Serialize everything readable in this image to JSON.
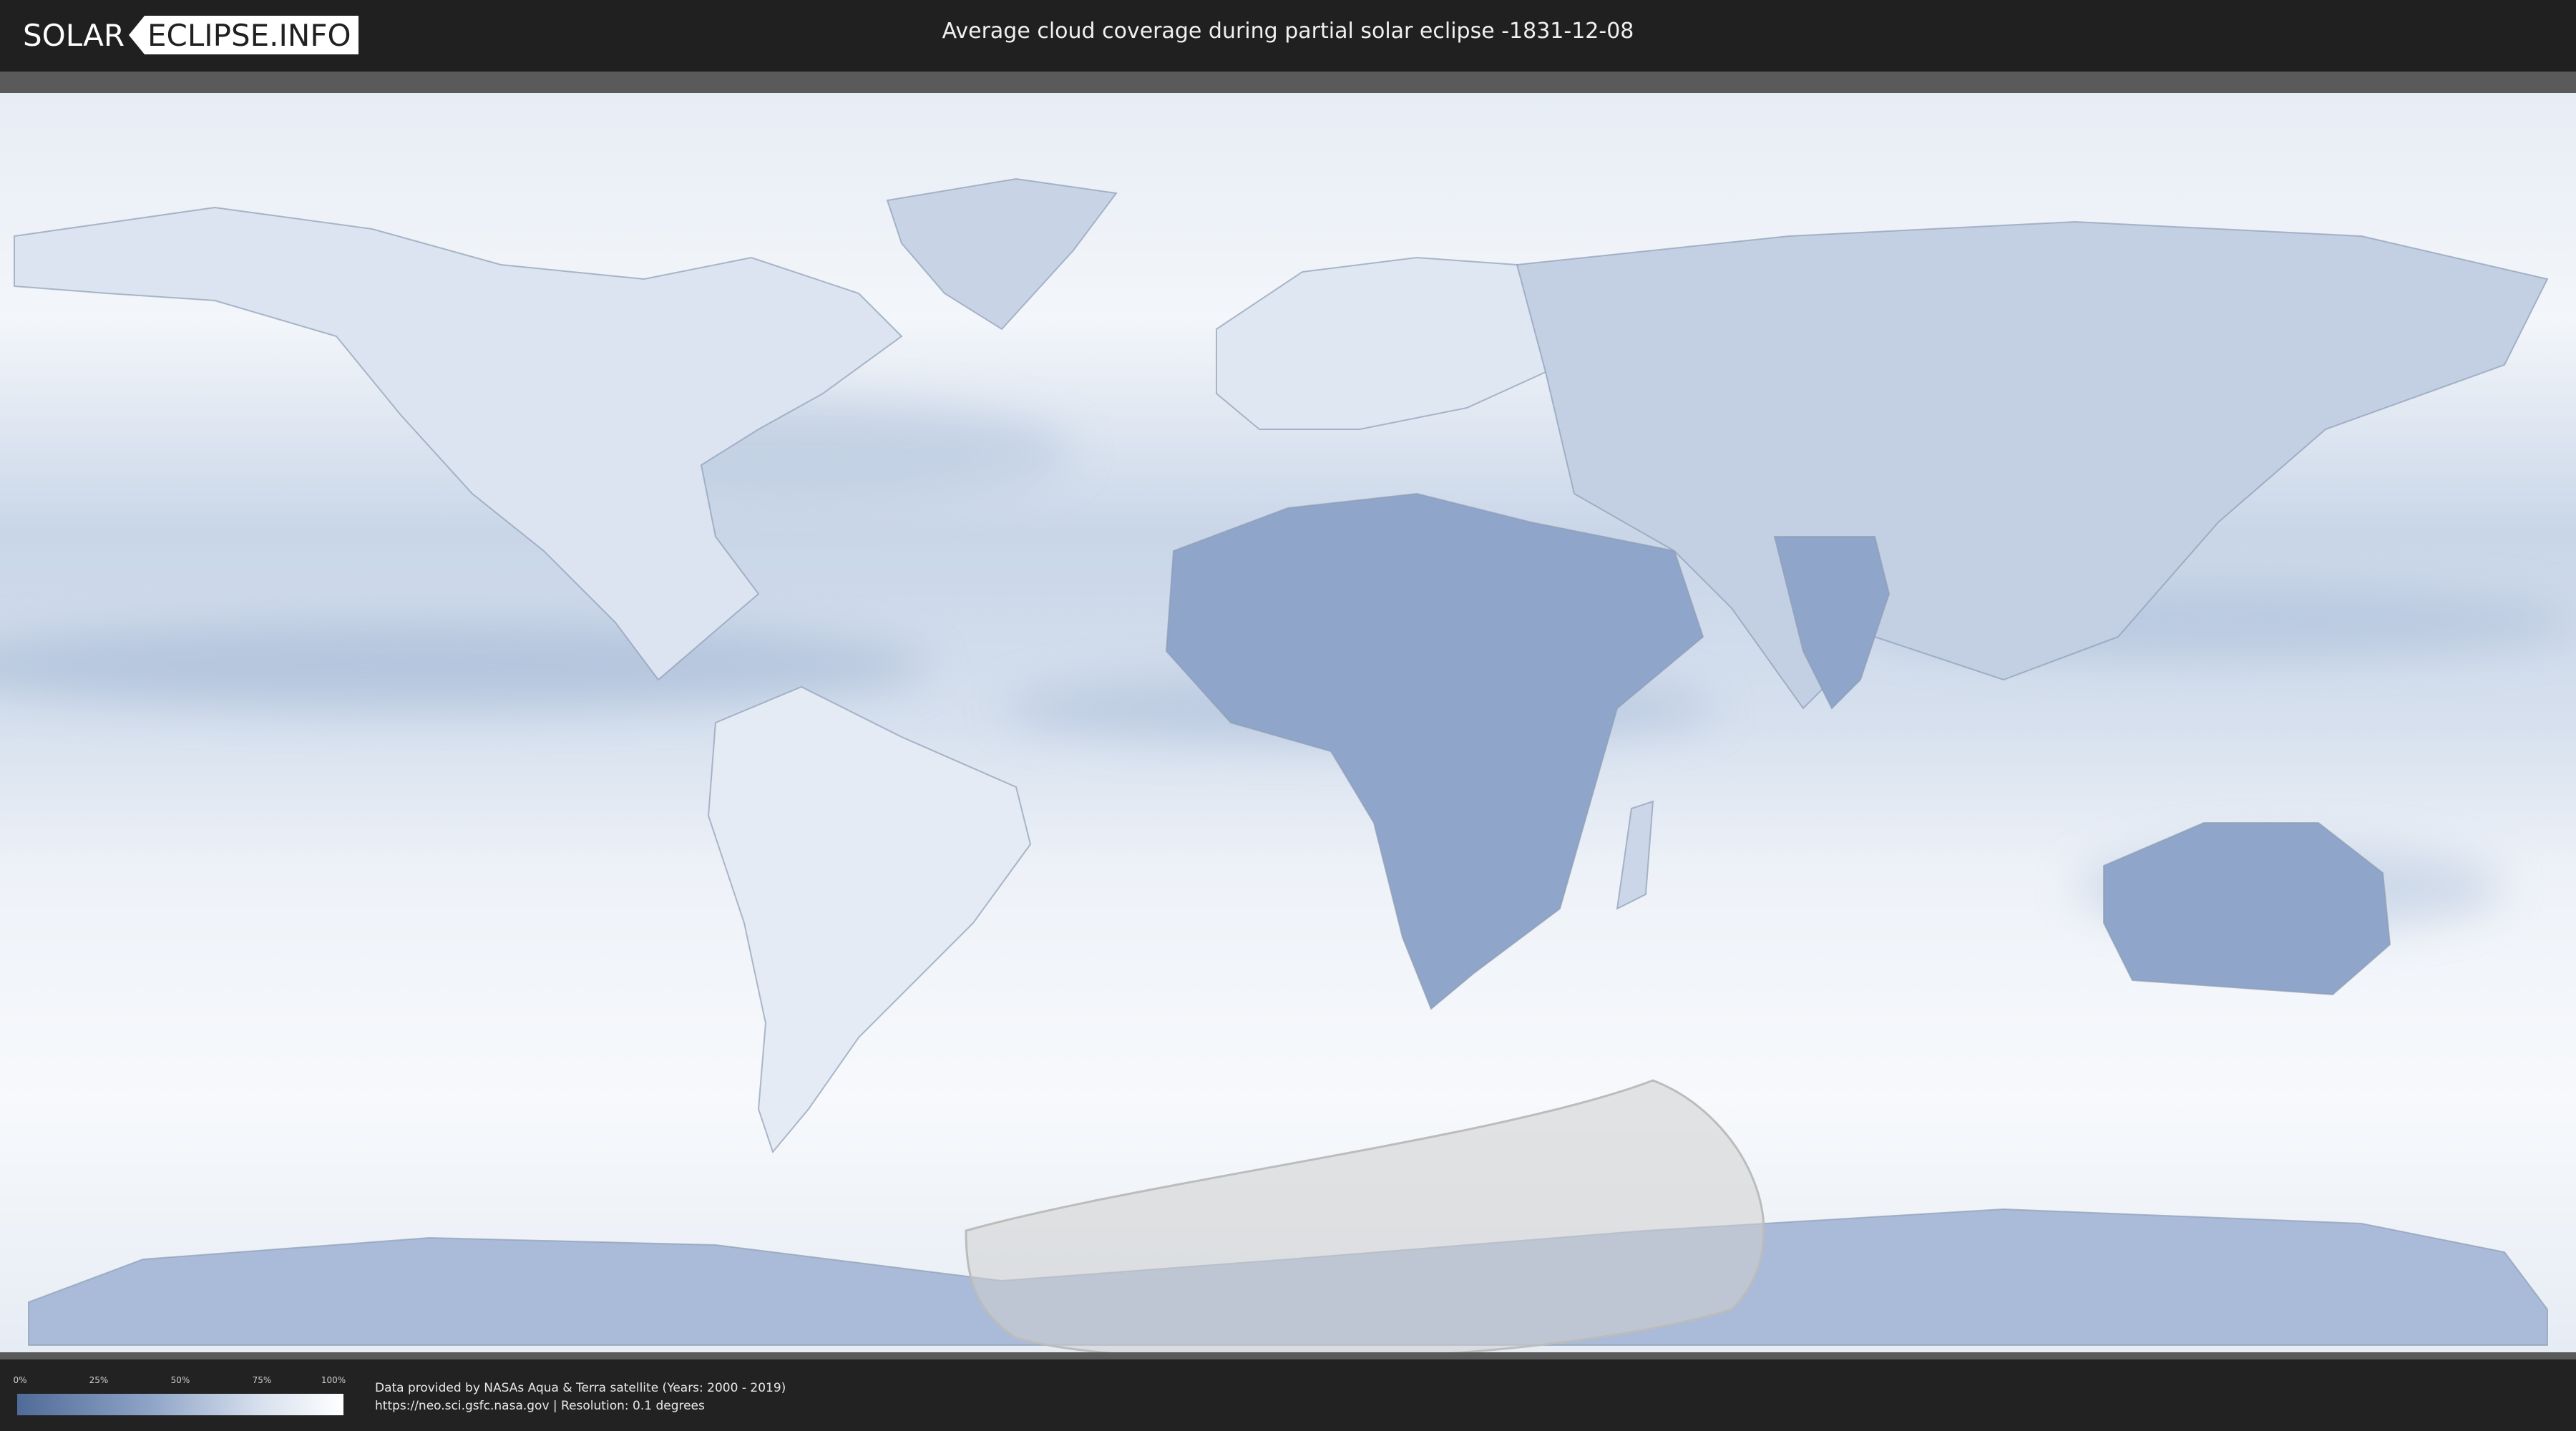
{
  "header": {
    "logo_left": "SOLAR",
    "logo_right": "ECLIPSE.INFO",
    "title": "Average cloud coverage during partial solar eclipse -1831-12-08"
  },
  "map": {
    "type": "world cloud coverage",
    "colors": {
      "clear_sky": "#4f6b98",
      "full_cloud": "#ffffff",
      "eclipse_zone": "#cfcfcf"
    }
  },
  "legend": {
    "ticks": [
      "0%",
      "25%",
      "50%",
      "75%",
      "100%"
    ]
  },
  "footer": {
    "credit_line1": "Data provided by NASAs Aqua & Terra satellite (Years: 2000 - 2019)",
    "credit_line2": "https://neo.sci.gsfc.nasa.gov | Resolution: 0.1 degrees"
  }
}
